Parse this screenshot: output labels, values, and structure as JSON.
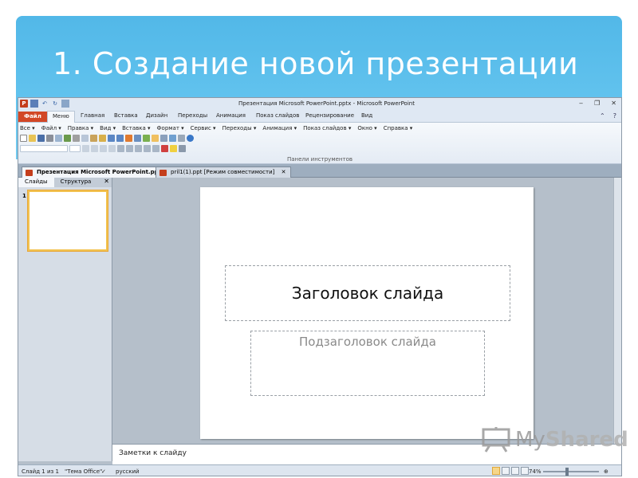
{
  "slide_title": "1. Создание новой презентации",
  "window": {
    "title": "Презентация Microsoft PowerPoint.pptx - Microsoft PowerPoint",
    "app_icon": "P",
    "controls": [
      "‒",
      "❐",
      "✕"
    ]
  },
  "ribbon_tabs": {
    "file": "Файл",
    "items": [
      "Меню",
      "Главная",
      "Вставка",
      "Дизайн",
      "Переходы",
      "Анимация",
      "Показ слайдов",
      "Рецензирование",
      "Вид"
    ]
  },
  "menu_bar": [
    "Все ▾",
    "Файл ▾",
    "Правка ▾",
    "Вид ▾",
    "Вставка ▾",
    "Формат ▾",
    "Сервис ▾",
    "Переходы ▾",
    "Анимация ▾",
    "Показ слайдов ▾",
    "Окно ▾",
    "Справка ▾"
  ],
  "toolbar_group_label": "Панели инструментов",
  "doc_tabs": [
    {
      "label": "Презентация Microsoft PowerPoint.pptx",
      "close": "✕"
    },
    {
      "label": "pril1(1).ppt [Режим совместимости]",
      "close": "✕"
    }
  ],
  "slides_pane": {
    "tabs": [
      "Слайды",
      "Структура"
    ],
    "close": "✕",
    "slide_number": "1"
  },
  "slide": {
    "title_placeholder": "Заголовок слайда",
    "subtitle_placeholder": "Подзаголовок слайда"
  },
  "notes_placeholder": "Заметки к слайду",
  "status": {
    "slide_info": "Слайд 1 из 1",
    "theme": "\"Тема Office\"",
    "language": "русский",
    "zoom": "74%"
  },
  "watermark": {
    "text_plain": "My",
    "text_bold": "Shared"
  }
}
